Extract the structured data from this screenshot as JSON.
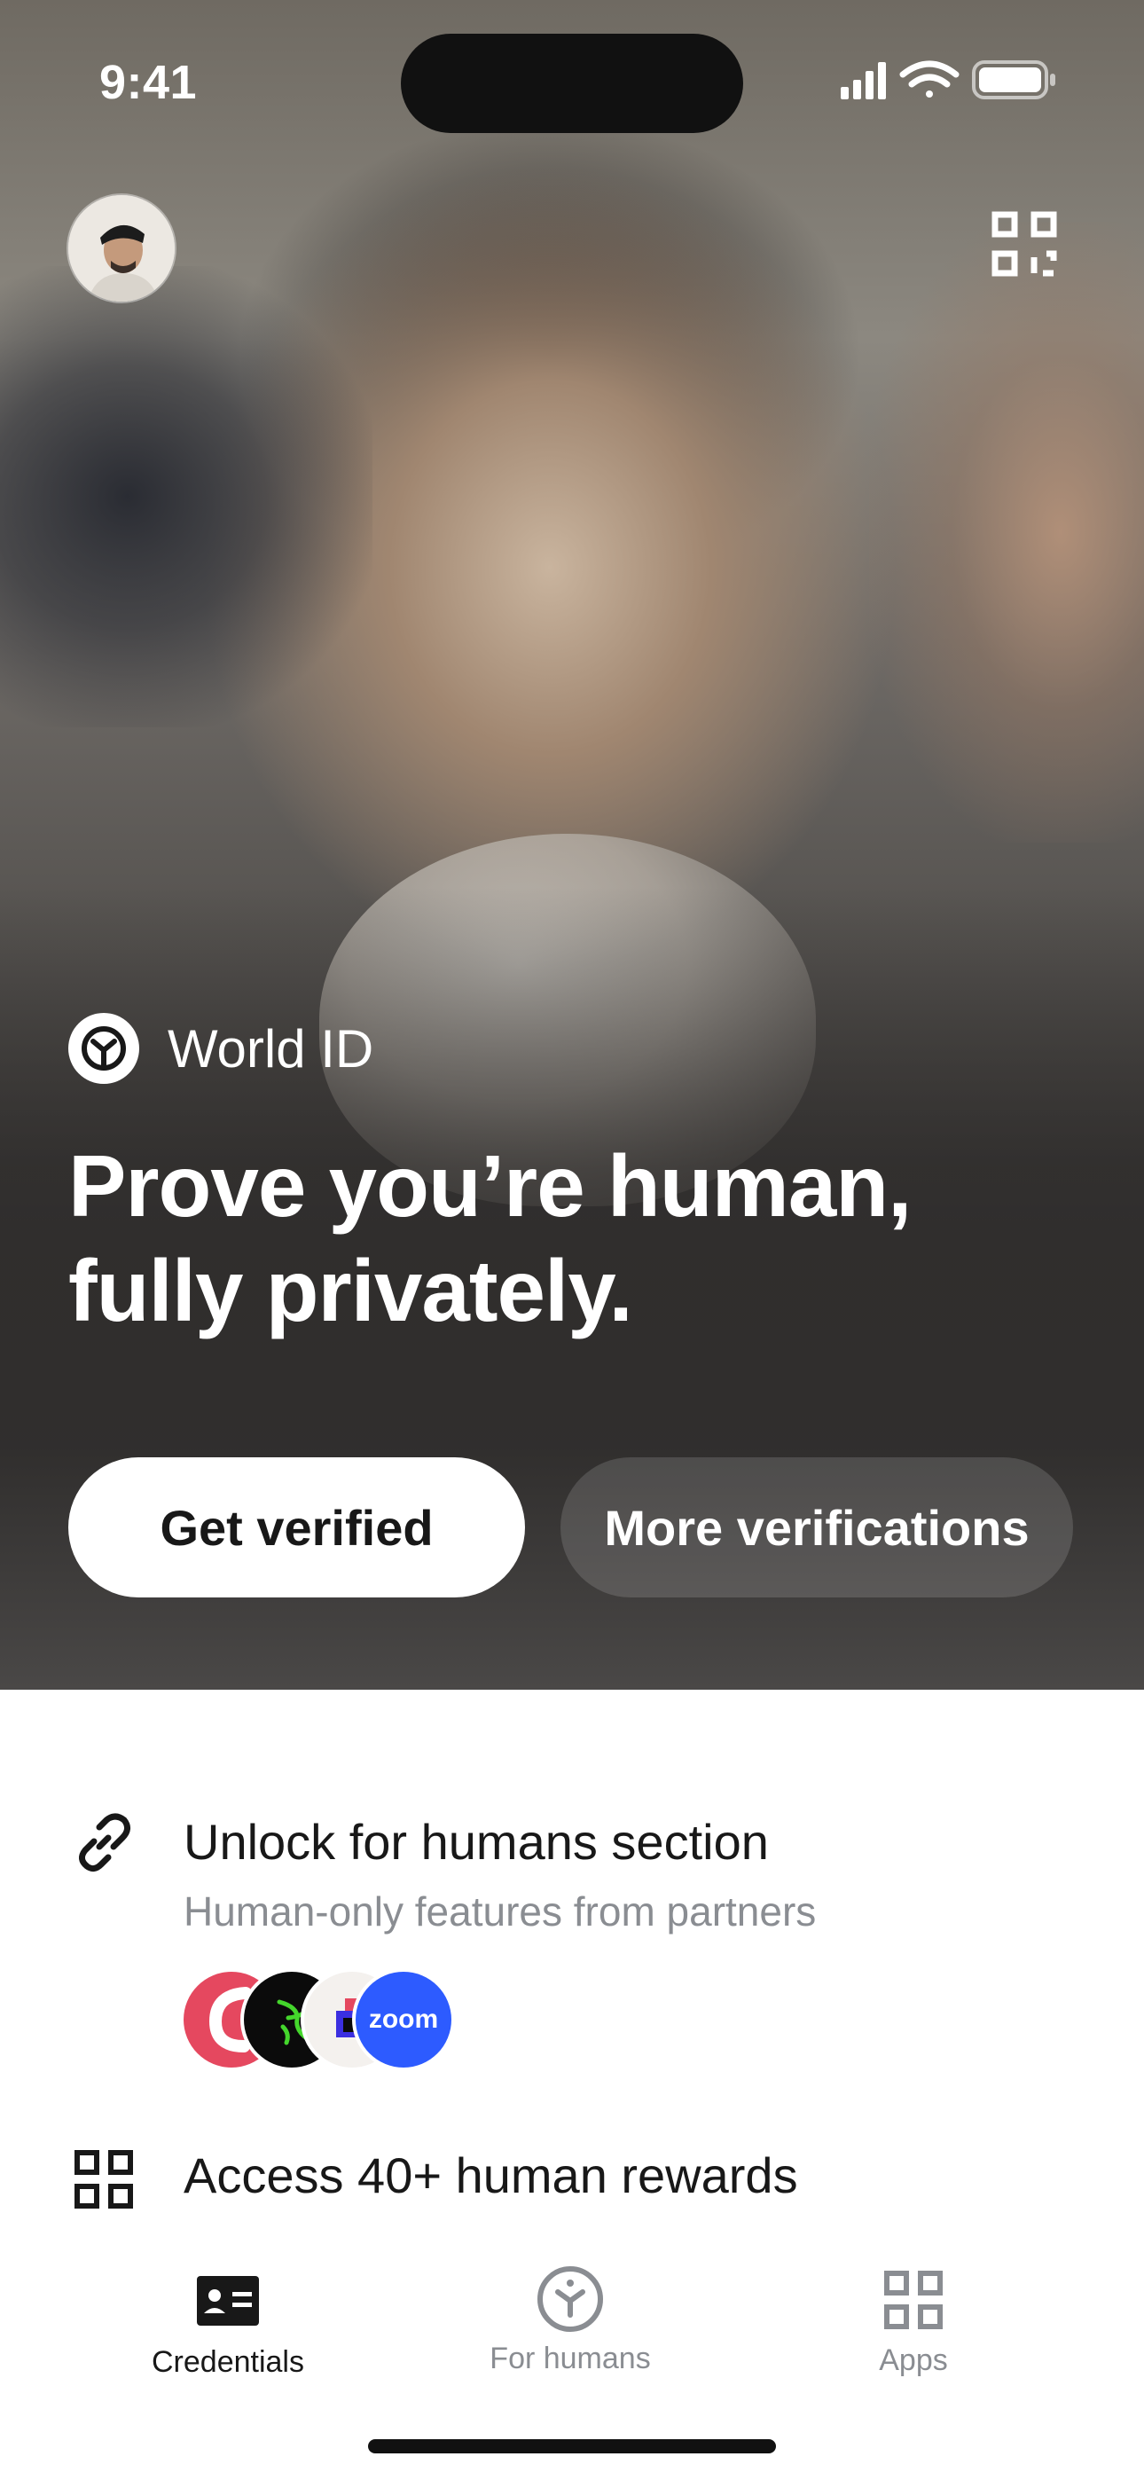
{
  "status_bar": {
    "time": "9:41"
  },
  "hero": {
    "brand_label": "World ID",
    "title": "Prove you’re human, fully privately.",
    "primary_button": "Get verified",
    "secondary_button": "More verifications"
  },
  "features": {
    "unlock": {
      "icon": "link-icon",
      "title": "Unlock for humans section",
      "subtitle": "Human-only features from partners",
      "partners": [
        {
          "name": "partner-red-logo",
          "label": ""
        },
        {
          "name": "razer-logo",
          "label": ""
        },
        {
          "name": "partner-square-logo",
          "label": ""
        },
        {
          "name": "zoom-logo",
          "label": "zoom"
        }
      ]
    },
    "rewards": {
      "icon": "grid-icon",
      "title": "Access 40+ human rewards"
    }
  },
  "tabbar": {
    "tabs": [
      {
        "label": "Credentials",
        "icon": "id-card-icon",
        "active": true
      },
      {
        "label": "For humans",
        "icon": "world-id-icon",
        "active": false
      },
      {
        "label": "Apps",
        "icon": "apps-grid-icon",
        "active": false
      }
    ]
  },
  "colors": {
    "active_tab": "#181818",
    "inactive_tab": "#8a8d92",
    "zoom_blue": "#2d5bff",
    "partner_red": "#e5485f"
  }
}
